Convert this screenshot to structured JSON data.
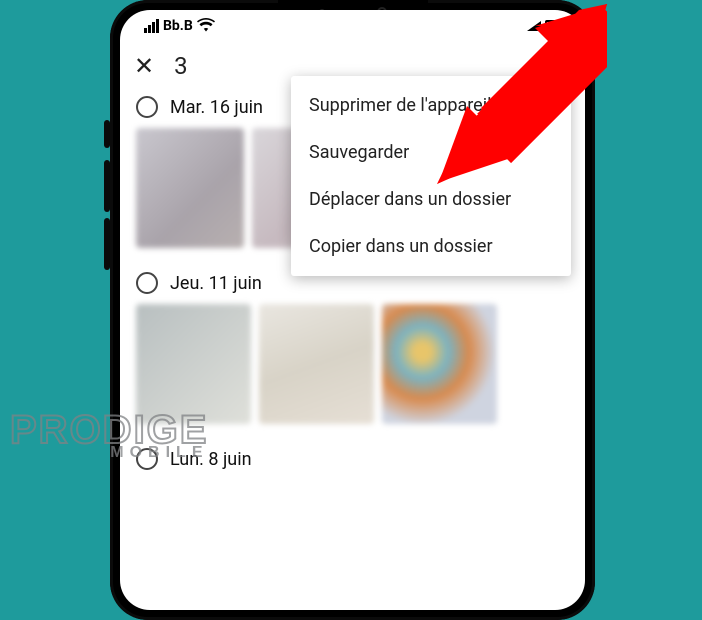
{
  "status": {
    "carrier": "Bb.B"
  },
  "header": {
    "selection_count": "3"
  },
  "menu": {
    "items": [
      "Supprimer de l'appareil",
      "Sauvegarder",
      "Déplacer dans un dossier",
      "Copier dans un dossier"
    ]
  },
  "groups": [
    {
      "date": "Mar. 16 juin"
    },
    {
      "date": "Jeu. 11 juin"
    },
    {
      "date": "Lun. 8 juin"
    }
  ],
  "watermark": {
    "brand": "PRODIGE",
    "sub": "MOBILE"
  }
}
